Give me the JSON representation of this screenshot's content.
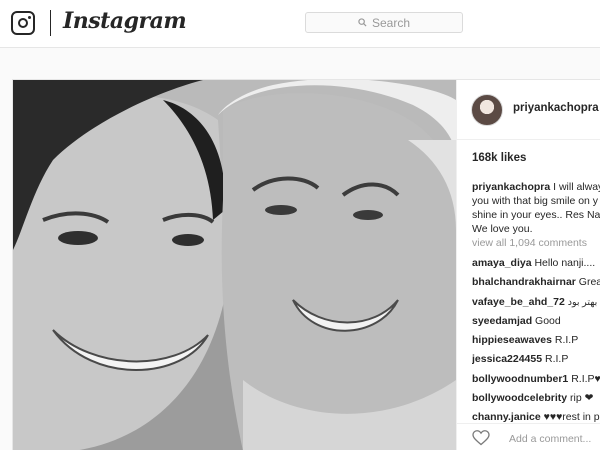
{
  "header": {
    "brand": "Instagram",
    "search_placeholder": "Search"
  },
  "post": {
    "username": "priyankachopra",
    "likes": "168k likes",
    "caption": {
      "username": "priyankachopra",
      "text": " I will alway you with that big smile on y the shine in your eyes.. Res Nani . We love you."
    },
    "view_all": "view all 1,094 comments",
    "comments": [
      {
        "user": "amaya_diya",
        "text": "Hello nanji...."
      },
      {
        "user": "bhalchandrakhairnar",
        "text": "Great"
      },
      {
        "user": "vafaye_be_ahd_72",
        "text": "بهتر بود"
      },
      {
        "user": "syeedamjad",
        "text": "Good"
      },
      {
        "user": "hippieseawaves",
        "text": "R.I.P"
      },
      {
        "user": "jessica224455",
        "text": "R.I.P"
      },
      {
        "user": "bollywoodnumber1",
        "text": "R.I.P♥♥"
      },
      {
        "user": "bollywoodcelebrity",
        "text": "rip ❤"
      },
      {
        "user": "channy.janice",
        "text": "♥♥♥rest in p"
      }
    ],
    "add_comment_placeholder": "Add a comment..."
  },
  "icons": {
    "logo": "instagram-glyph-icon",
    "search": "search-icon",
    "like": "heart-icon"
  },
  "colors": {
    "text": "#262626",
    "muted": "#999999",
    "border": "#e6e6e6",
    "background": "#fafafa"
  }
}
